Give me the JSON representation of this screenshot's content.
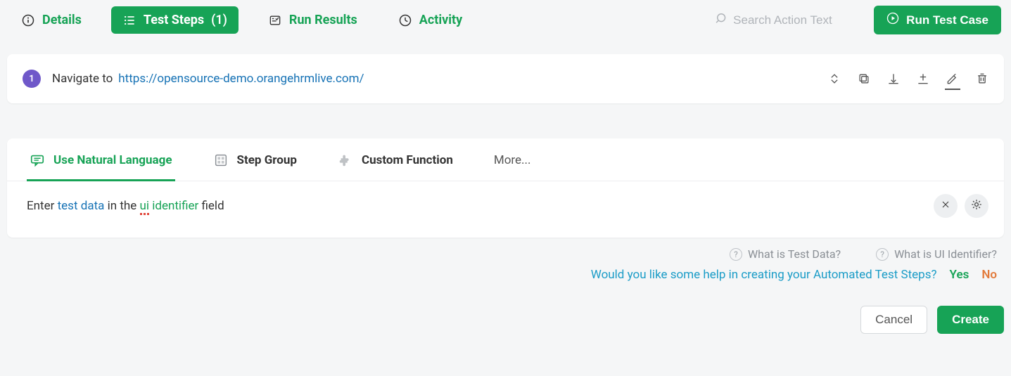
{
  "topbar": {
    "tabs": {
      "details": "Details",
      "steps_label": "Test Steps",
      "steps_count": "(1)",
      "results": "Run Results",
      "activity": "Activity"
    },
    "search_placeholder": "Search Action Text",
    "run_label": "Run Test Case"
  },
  "step": {
    "num": "1",
    "verb": "Navigate to",
    "url": "https://opensource-demo.orangehrmlive.com/"
  },
  "composer": {
    "tabs": {
      "nl": "Use Natural Language",
      "group": "Step Group",
      "custom": "Custom Function",
      "more": "More..."
    },
    "nl_prefix": "Enter",
    "nl_testdata": "test data",
    "nl_mid": "in the",
    "nl_ui1": "ui",
    "nl_ui2": "identifier",
    "nl_suffix": "field"
  },
  "helps": {
    "testdata": "What is Test Data?",
    "uiid": "What is UI Identifier?",
    "suggest_text": "Would you like some help in creating your Automated Test Steps?",
    "yes": "Yes",
    "no": "No"
  },
  "footer": {
    "cancel": "Cancel",
    "create": "Create"
  }
}
